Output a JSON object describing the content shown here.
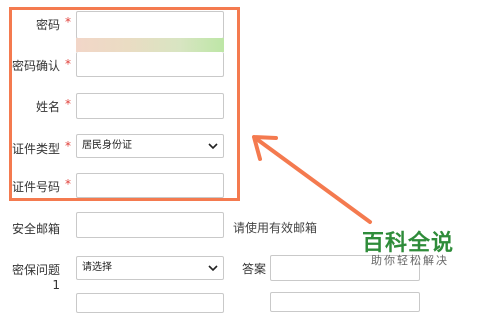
{
  "form": {
    "password": {
      "label": "密码",
      "required": "*"
    },
    "password_confirm": {
      "label": "密码确认",
      "required": "*"
    },
    "name": {
      "label": "姓名",
      "required": "*"
    },
    "id_type": {
      "label": "证件类型",
      "required": "*",
      "selected": "居民身份证"
    },
    "id_number": {
      "label": "证件号码",
      "required": "*"
    },
    "email": {
      "label": "安全邮箱",
      "hint": "请使用有效邮箱"
    },
    "security_question": {
      "label": "密保问题1",
      "selected": "请选择"
    },
    "answer": {
      "label": "答案"
    }
  },
  "brand": {
    "title": "百科全说",
    "subtitle": "助你轻松解决"
  },
  "colors": {
    "highlight": "#f47a4f",
    "required": "#e0403a",
    "brand": "#2f8c3a"
  }
}
